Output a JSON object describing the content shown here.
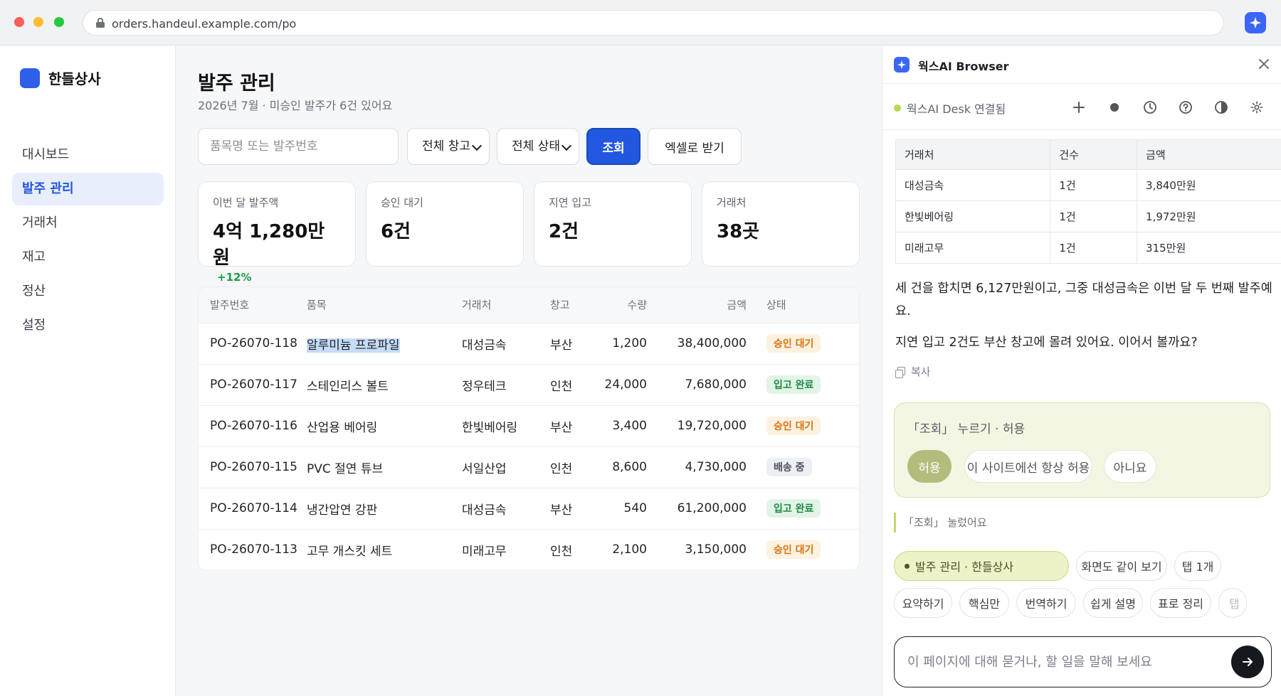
{
  "browser": {
    "url": "orders.handeul.example.com/po"
  },
  "sidebar": {
    "brand": "한들상사",
    "items": [
      {
        "label": "대시보드",
        "active": false
      },
      {
        "label": "발주 관리",
        "active": true
      },
      {
        "label": "거래처",
        "active": false
      },
      {
        "label": "재고",
        "active": false
      },
      {
        "label": "정산",
        "active": false
      },
      {
        "label": "설정",
        "active": false
      }
    ]
  },
  "main": {
    "title": "발주 관리",
    "subtitle": "2026년 7월 · 미승인 발주가 6건 있어요",
    "filters": {
      "search_placeholder": "품목명 또는 발주번호",
      "warehouse": "전체 창고",
      "status": "전체 상태",
      "query_button": "조회",
      "excel_button": "엑셀로 받기"
    },
    "stats": [
      {
        "label": "이번 달 발주액",
        "value": "4억 1,280만원",
        "delta": "+12%"
      },
      {
        "label": "승인 대기",
        "value": "6건"
      },
      {
        "label": "지연 입고",
        "value": "2건"
      },
      {
        "label": "거래처",
        "value": "38곳"
      }
    ],
    "table": {
      "headers": [
        "발주번호",
        "품목",
        "거래처",
        "창고",
        "수량",
        "금액",
        "상태"
      ],
      "rows": [
        {
          "no": "PO-26070-118",
          "item": "알루미늄 프로파일",
          "vendor": "대성금속",
          "warehouse": "부산",
          "qty": "1,200",
          "amount": "38,400,000",
          "status": "승인 대기"
        },
        {
          "no": "PO-26070-117",
          "item": "스테인리스 볼트",
          "vendor": "정우테크",
          "warehouse": "인천",
          "qty": "24,000",
          "amount": "7,680,000",
          "status": "입고 완료"
        },
        {
          "no": "PO-26070-116",
          "item": "산업용 베어링",
          "vendor": "한빛베어링",
          "warehouse": "부산",
          "qty": "3,400",
          "amount": "19,720,000",
          "status": "승인 대기"
        },
        {
          "no": "PO-26070-115",
          "item": "PVC 절연 튜브",
          "vendor": "서일산업",
          "warehouse": "인천",
          "qty": "8,600",
          "amount": "4,730,000",
          "status": "배송 중"
        },
        {
          "no": "PO-26070-114",
          "item": "냉간압연 강판",
          "vendor": "대성금속",
          "warehouse": "부산",
          "qty": "540",
          "amount": "61,200,000",
          "status": "입고 완료"
        },
        {
          "no": "PO-26070-113",
          "item": "고무 개스킷 세트",
          "vendor": "미래고무",
          "warehouse": "인천",
          "qty": "2,100",
          "amount": "3,150,000",
          "status": "승인 대기"
        }
      ]
    }
  },
  "panel": {
    "title": "웍스AI Browser",
    "connection": "웍스AI Desk 연결됨",
    "summary_table": {
      "headers": [
        "거래처",
        "건수",
        "금액"
      ],
      "rows": [
        [
          "대성금속",
          "1건",
          "3,840만원"
        ],
        [
          "한빛베어링",
          "1건",
          "1,972만원"
        ],
        [
          "미래고무",
          "1건",
          "315만원"
        ]
      ]
    },
    "message1": "세 건을 합치면 6,127만원이고, 그중 대성금속은 이번 달 두 번째 발주예요.",
    "message2": "지연 입고 2건도 부산 창고에 몰려 있어요. 이어서 볼까요?",
    "copy_label": "복사",
    "confirm": {
      "title": "「조회」 누르기 · 허용",
      "allow": "허용",
      "always": "이 사이트에선 항상 허용",
      "no": "아니요"
    },
    "log": "「조회」 눌렀어요",
    "chips_row1": [
      "발주 관리 · 한들상사",
      "화면도 같이 보기",
      "탭 1개"
    ],
    "chips_row2": [
      "요약하기",
      "핵심만",
      "번역하기",
      "쉽게 설명",
      "표로 정리",
      "탭"
    ],
    "composer_placeholder": "이 페이지에 대해 묻거나, 할 일을 말해 보세요"
  }
}
